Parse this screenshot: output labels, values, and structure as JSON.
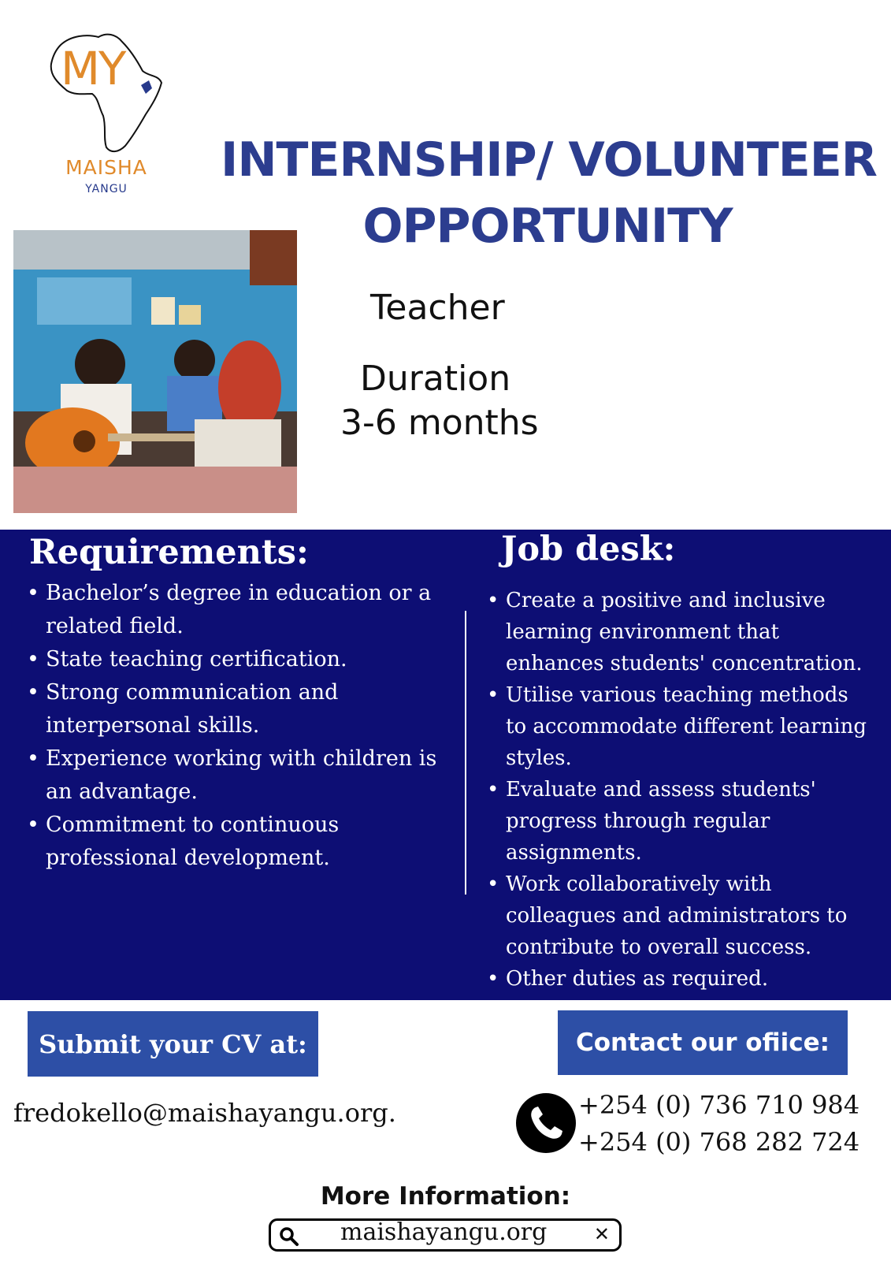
{
  "logo": {
    "monogram": "MY",
    "name": "MAISHA",
    "subname": "YANGU"
  },
  "heading": {
    "line1": "INTERNSHIP/ VOLUNTEER",
    "line2": "OPPORTUNITY"
  },
  "role": "Teacher",
  "duration": {
    "label": "Duration",
    "value": "3-6 months"
  },
  "requirements": {
    "title": "Requirements:",
    "items": [
      "Bachelor’s degree in education or a related field.",
      " State teaching certification.",
      "Strong communication and interpersonal skills.",
      "Experience working with children is an advantage.",
      "Commitment to continuous professional development."
    ]
  },
  "job_desk": {
    "title": "Job desk:",
    "items": [
      " Create a positive and inclusive learning environment that enhances students' concentration.",
      " Utilise various teaching methods to accommodate different learning styles.",
      " Evaluate and assess students' progress through regular assignments.",
      " Work collaboratively with colleagues and administrators to contribute to overall success.",
      " Other duties as required."
    ]
  },
  "submit": {
    "label": "Submit your CV at:",
    "email": "fredokello@maishayangu.org."
  },
  "contact": {
    "label": "Contact our ofiice:",
    "phones": [
      "+254 (0) 736 710 984",
      "+254 (0) 768 282 724"
    ]
  },
  "more_info": {
    "label": "More Information:",
    "website": "maishayangu.org"
  },
  "colors": {
    "brand_blue": "#2c3d8f",
    "band_navy": "#0d0e74",
    "button_blue": "#2d4fa6",
    "logo_orange": "#e08a2b"
  }
}
